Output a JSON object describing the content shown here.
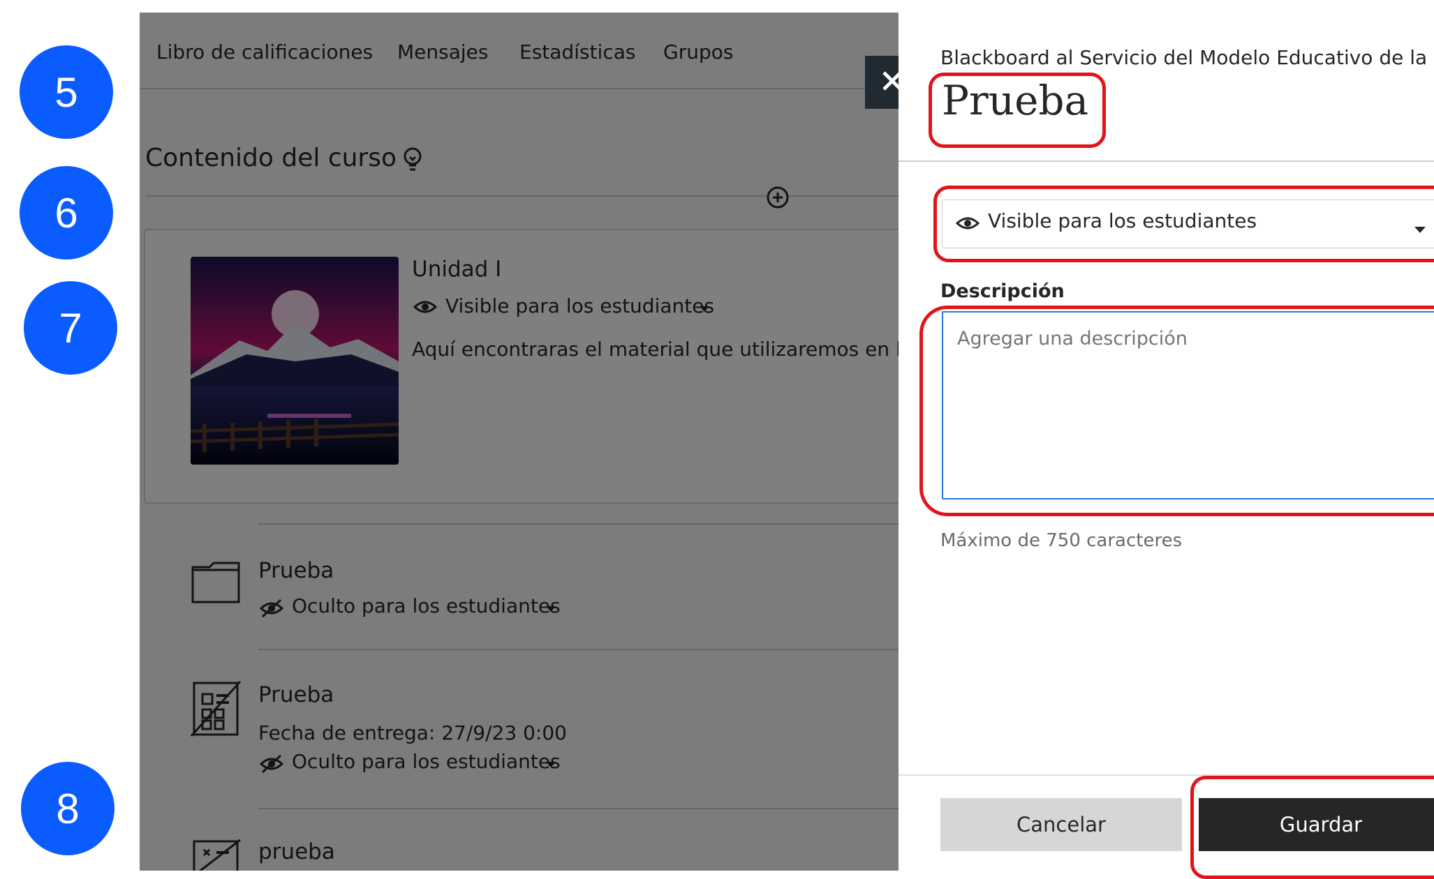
{
  "steps": [
    "5",
    "6",
    "7",
    "8"
  ],
  "course_nav": {
    "tabs": [
      "Libro de calificaciones",
      "Mensajes",
      "Estadísticas",
      "Grupos"
    ]
  },
  "course_content": {
    "heading": "Contenido del curso",
    "heading_icon": "lightbulb-icon",
    "add_icon": "plus-circle-icon",
    "unit": {
      "title": "Unidad I",
      "visibility": "Visible para los estudiantes",
      "description": "Aquí encontraras el material que utilizaremos en la ur"
    },
    "items": [
      {
        "icon": "folder-icon",
        "title": "Prueba",
        "visibility": "Oculto para los estudiantes"
      },
      {
        "icon": "assessment-icon",
        "title": "Prueba",
        "due": "Fecha de entrega: 27/9/23 0:00",
        "visibility": "Oculto para los estudiantes"
      },
      {
        "icon": "assessment-icon",
        "title": "prueba"
      }
    ]
  },
  "panel": {
    "breadcrumb": "Blackboard al Servicio del Modelo Educativo de la UP ...",
    "title": "Prueba",
    "close_icon": "close-icon",
    "visibility_select": "Visible para los estudiantes",
    "description_label": "Descripción",
    "description_placeholder": "Agregar una descripción",
    "description_hint": "Máximo de 750 caracteres",
    "cancel_label": "Cancelar",
    "save_label": "Guardar"
  },
  "colors": {
    "step_blue": "#0a5cff",
    "highlight_red": "#e0151a",
    "save_bg": "#262626",
    "cancel_bg": "#d6d6d6"
  }
}
